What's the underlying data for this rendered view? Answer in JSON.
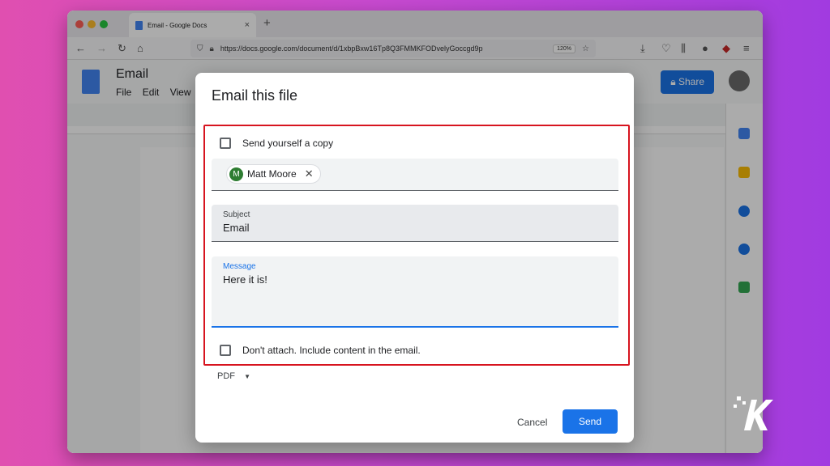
{
  "browser": {
    "tab_title": "Email - Google Docs",
    "tab_close": "×",
    "new_tab": "+",
    "url": "https://docs.google.com/document/d/1xbpBxw16Tp8Q3FMMKFODvelyGoccgd9p",
    "zoom": "120%"
  },
  "docs": {
    "title": "Email",
    "menu": [
      "File",
      "Edit",
      "View"
    ],
    "share_label": "Share"
  },
  "dialog": {
    "title": "Email this file",
    "send_copy_label": "Send yourself a copy",
    "recipient": {
      "initial": "M",
      "name": "Matt Moore"
    },
    "remove_recipient": "✕",
    "subject_label": "Subject",
    "subject_value": "Email",
    "message_label": "Message",
    "message_value": "Here it is!",
    "dont_attach_label": "Don't attach. Include content in the email.",
    "format_value": "PDF",
    "cancel_label": "Cancel",
    "send_label": "Send"
  },
  "colors": {
    "accent": "#1a73e8",
    "highlight_box": "#d7141f",
    "recipient_avatar": "#2e7d32"
  }
}
